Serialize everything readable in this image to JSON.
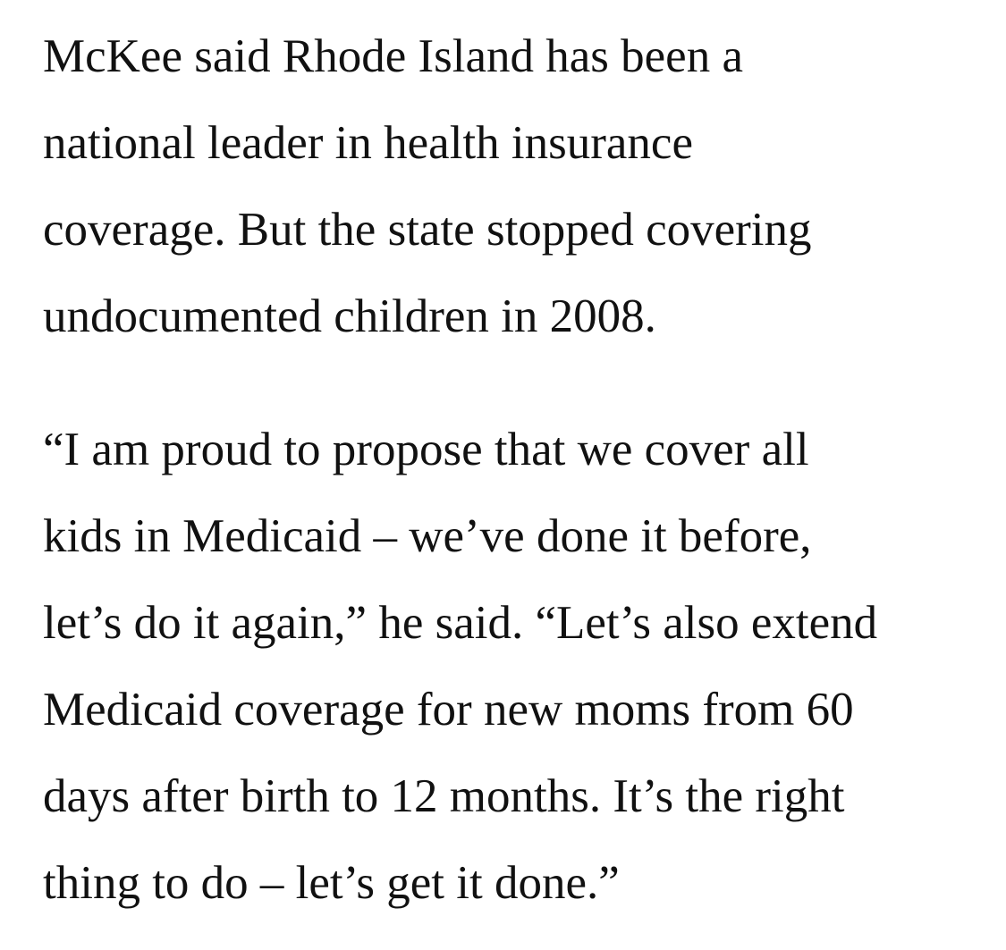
{
  "article": {
    "paragraphs": [
      {
        "lines": [
          "McKee said Rhode Island has been a",
          "national leader in health insurance",
          "coverage. But the state stopped covering",
          "undocumented children in 2008."
        ]
      },
      {
        "lines": [
          "“I am proud to propose that we cover all",
          "kids in Medicaid – we’ve done it before,",
          "let’s do it again,” he said. “Let’s also extend",
          "Medicaid coverage for new moms from 60",
          "days after birth to 12 months. It’s the right",
          "thing to do – let’s get it done.”"
        ]
      }
    ]
  }
}
